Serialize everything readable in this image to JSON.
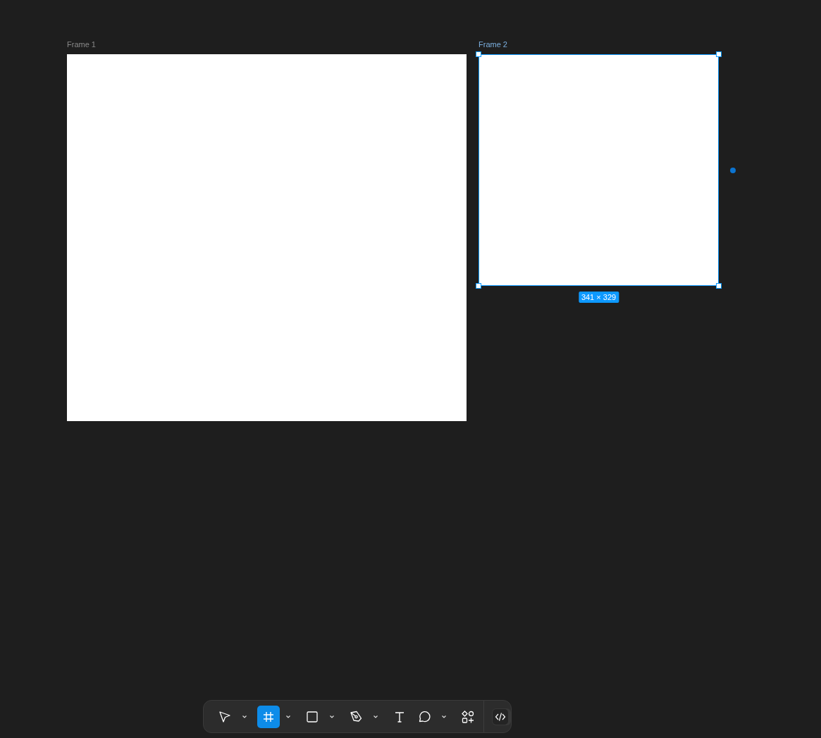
{
  "frames": [
    {
      "name": "Frame 1",
      "selected": false
    },
    {
      "name": "Frame 2",
      "selected": true,
      "size": "341 × 329"
    }
  ],
  "toolbar": {
    "tools": [
      {
        "kind": "move",
        "selected": false,
        "dropdown": true
      },
      {
        "kind": "frame",
        "selected": true,
        "dropdown": true
      },
      {
        "kind": "rectangle",
        "selected": false,
        "dropdown": true
      },
      {
        "kind": "pen",
        "selected": false,
        "dropdown": true
      },
      {
        "kind": "text",
        "selected": false,
        "dropdown": false
      },
      {
        "kind": "comment",
        "selected": false,
        "dropdown": true
      },
      {
        "kind": "actions",
        "selected": false,
        "dropdown": false
      }
    ],
    "dev_mode": {
      "on": false
    }
  }
}
